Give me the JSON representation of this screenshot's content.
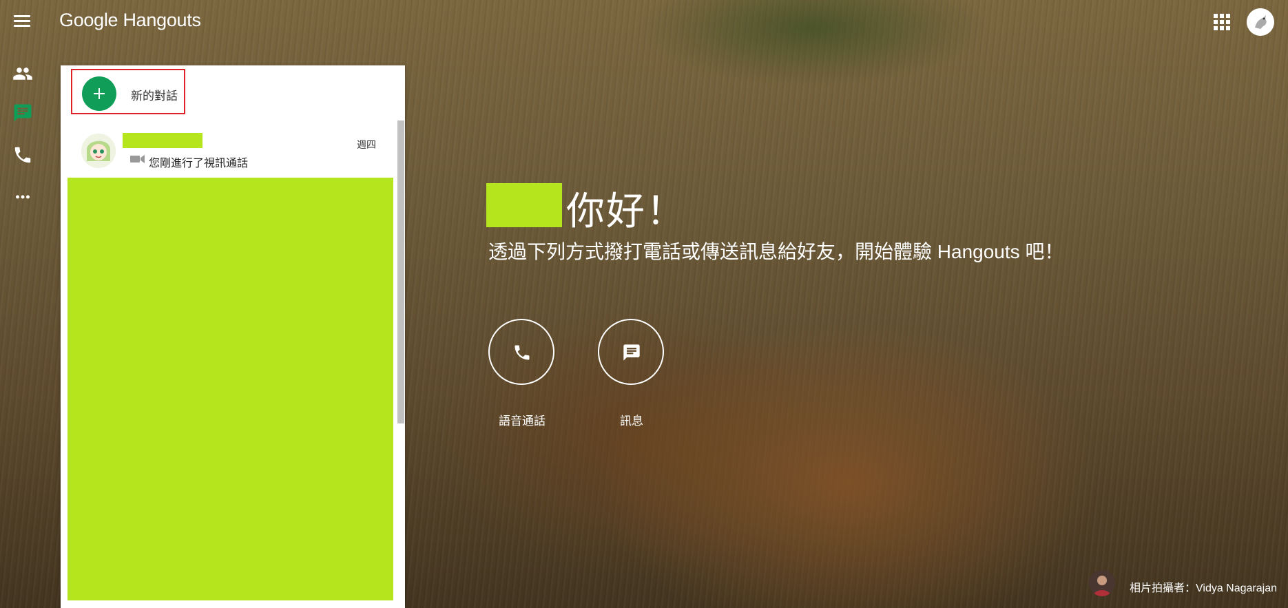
{
  "app": {
    "logo_google": "Google",
    "logo_hangouts": "Hangouts"
  },
  "header": {
    "menu_icon": "hamburger-menu-icon",
    "apps_icon": "google-apps-grid-icon",
    "account_icon": "account-avatar-icon"
  },
  "sidebar": {
    "items": [
      {
        "icon": "contacts-icon",
        "active": false
      },
      {
        "icon": "chat-icon",
        "active": true
      },
      {
        "icon": "phone-icon",
        "active": false
      },
      {
        "icon": "more-horiz-icon",
        "active": false
      }
    ]
  },
  "conversations": {
    "new_label": "新的對話",
    "items": [
      {
        "day": "週四",
        "last_message": "您剛進行了視訊通話",
        "message_icon": "videocam-icon"
      }
    ]
  },
  "greeting": {
    "hello": "你好！",
    "subtitle": "透過下列方式撥打電話或傳送訊息給好友，開始體驗 Hangouts 吧！"
  },
  "actions": [
    {
      "label": "語音通話",
      "icon": "phone-icon"
    },
    {
      "label": "訊息",
      "icon": "message-icon"
    }
  ],
  "photo_credit": "相片拍攝者：Vidya Nagarajan",
  "colors": {
    "accent_green": "#0f9d58",
    "redaction": "#b5e61d",
    "highlight_border": "#e0202a"
  }
}
